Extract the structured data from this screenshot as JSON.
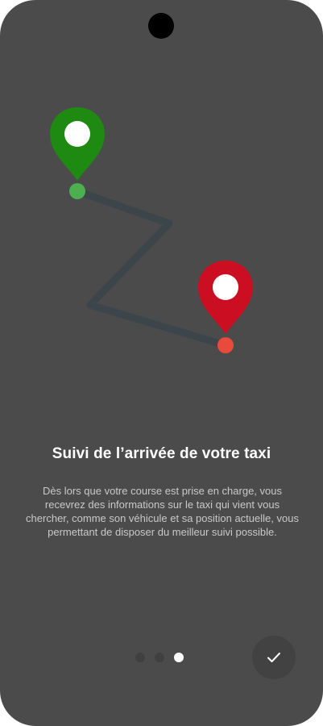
{
  "onboarding": {
    "title": "Suivi de l’arrivée de votre taxi",
    "description": "Dès lors que votre course est prise en charge, vous recevrez des informations sur le taxi qui vient vous chercher, comme son véhicule et sa position actuelle, vous permettant de disposer du meilleur suivi possible.",
    "page_indicator": {
      "total": 3,
      "current": 3
    }
  },
  "icons": {
    "start_pin": "map-pin-icon",
    "end_pin": "map-pin-icon",
    "done": "checkmark-icon"
  },
  "colors": {
    "background": "#4a4b4a",
    "start_pin": "#1e8a12",
    "start_dot": "#4caf50",
    "end_pin": "#cc0e22",
    "end_dot": "#e84a3c",
    "route": "#3c464a"
  }
}
